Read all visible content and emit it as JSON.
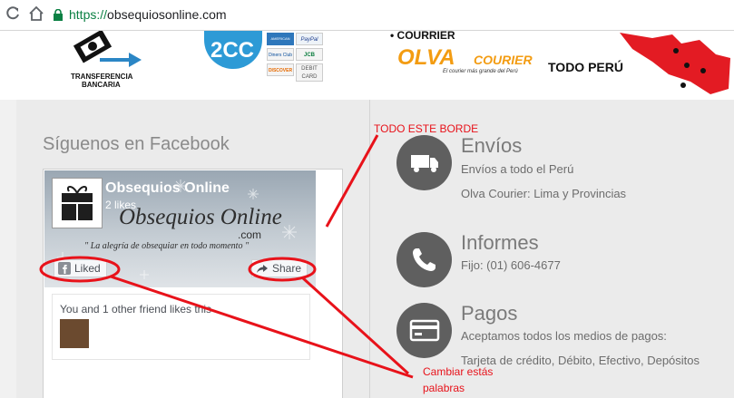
{
  "browser": {
    "url_scheme": "https://",
    "url_host": "obsequiosonline.com"
  },
  "logos": {
    "transfer_line1": "TRANSFERENCIA",
    "transfer_line2": "BANCARIA",
    "twocc": "2CC",
    "cards": [
      "AMERICAN EXPRESS",
      "PayPal",
      "Diners Club",
      "JCB",
      "DISCOVER",
      "DEBIT CARD"
    ],
    "courier_label": "• COURRIER",
    "olva": "OLVA",
    "olva_courier": "COURIER",
    "olva_tagline": "El courier más grande del Perú",
    "todo_peru": "TODO PERÚ"
  },
  "facebook": {
    "heading": "Síguenos en Facebook",
    "page_name": "Obsequios Online",
    "likes": "2 likes",
    "cover_brand": "Obsequios Online",
    "cover_com": ".com",
    "cover_tagline": "\" La alegría de obsequiar en todo momento \"",
    "liked_label": "Liked",
    "share_label": "Share",
    "social_text": "You and 1 other friend likes this"
  },
  "services": [
    {
      "title": "Envíos",
      "lines": [
        "Envíos a todo el Perú",
        "Olva Courier: Lima y Provincias"
      ],
      "icon": "truck-icon"
    },
    {
      "title": "Informes",
      "lines": [
        "Fijo: (01) 606-4677"
      ],
      "icon": "phone-icon"
    },
    {
      "title": "Pagos",
      "lines": [
        "Aceptamos todos los medios de pagos:",
        "Tarjeta de crédito, Débito, Efectivo, Depósitos"
      ],
      "icon": "credit-card-icon"
    }
  ],
  "annotations": {
    "border_note": "TODO ESTE BORDE",
    "words_note_line1": "Cambiar estás",
    "words_note_line2": "palabras",
    "color": "#e8121a"
  },
  "colors": {
    "url_secure": "#0b8043",
    "panel_bg": "#ebebeb",
    "icon_circle": "#5f5f5f",
    "olva_orange": "#f39c12",
    "map_red": "#e31b23"
  }
}
